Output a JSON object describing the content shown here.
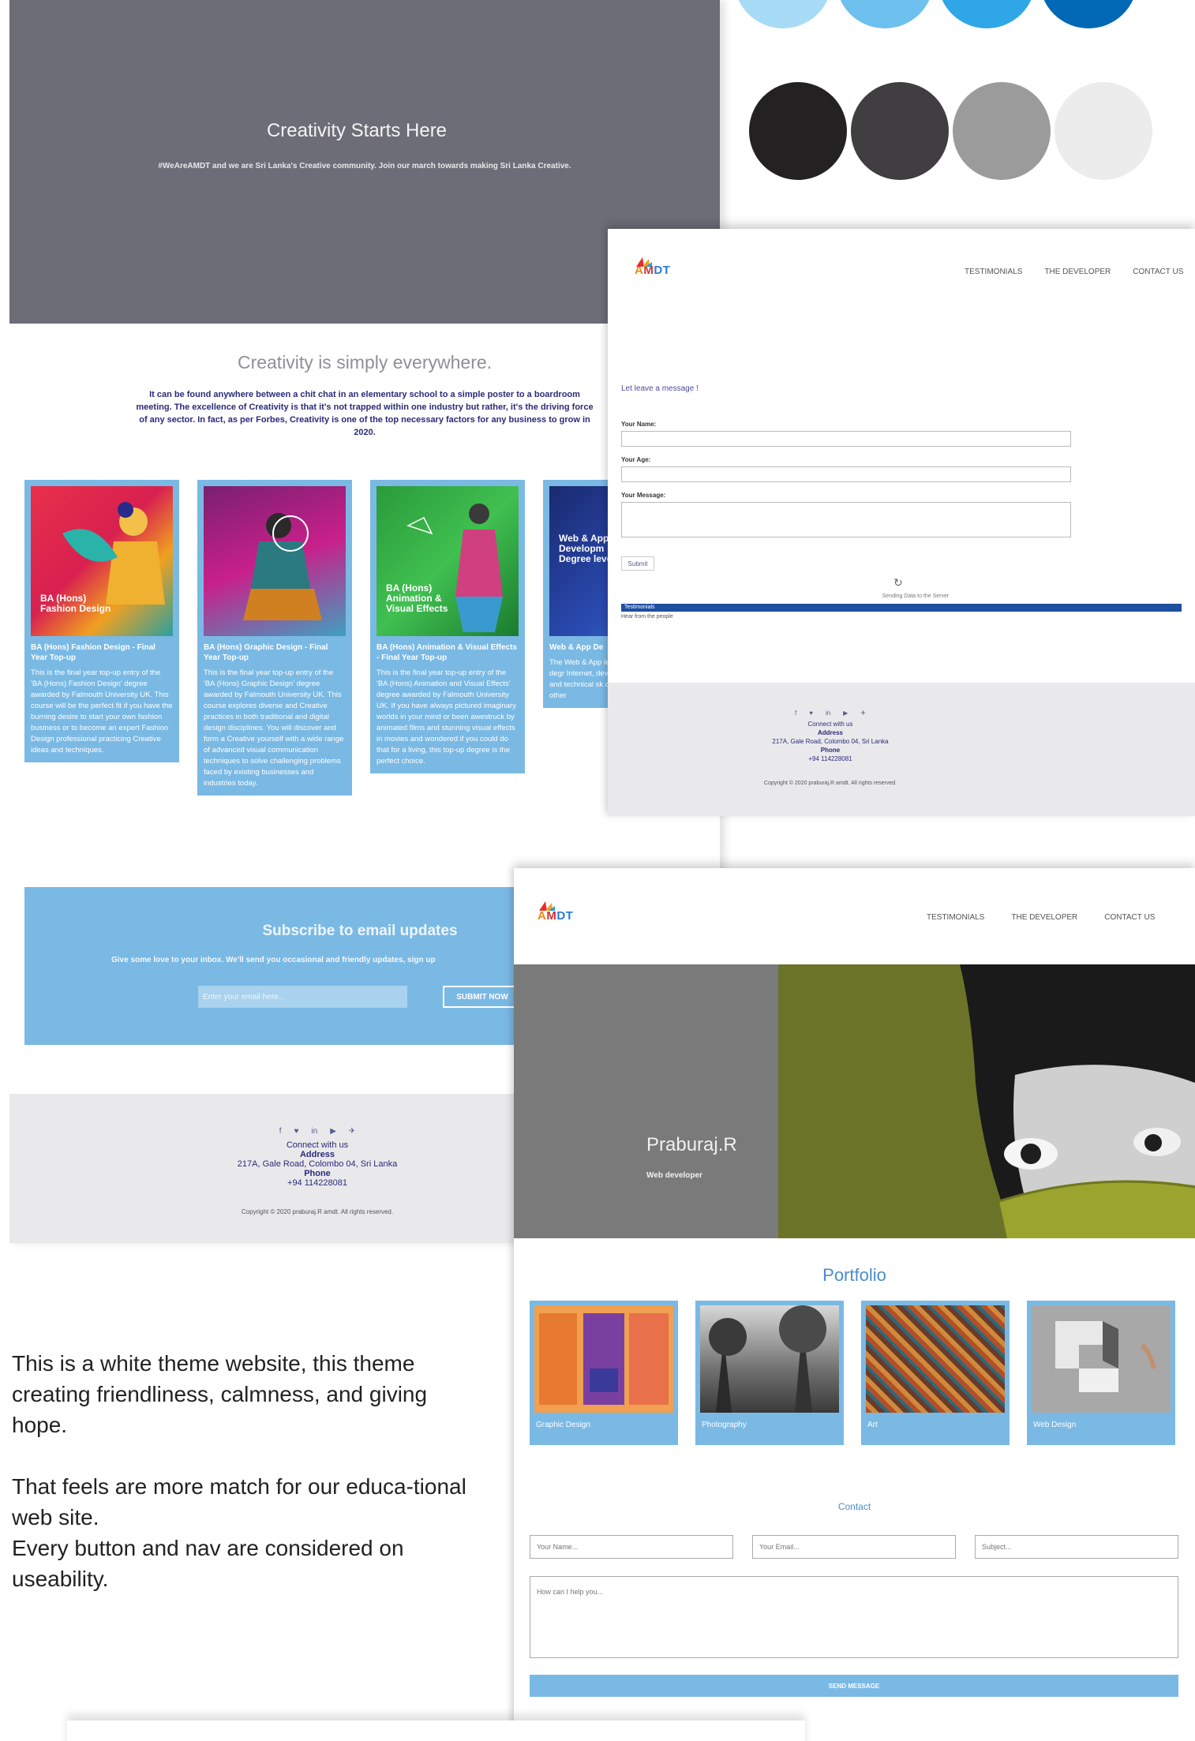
{
  "palette": {
    "blues": [
      "#a8dcf6",
      "#6ec0ee",
      "#2fa6e6",
      "#0068b4"
    ],
    "grays": [
      "#232122",
      "#403e40",
      "#9b9b9b",
      "#ececec"
    ]
  },
  "main_site": {
    "hero": {
      "title": "Creativity Starts Here",
      "subtitle": "#WeAreAMDT and we are Sri Lanka's Creative community. Join our march towards making Sri Lanka Creative."
    },
    "intro": {
      "title": "Creativity is simply everywhere.",
      "text": "It can be found anywhere between a chit chat in an elementary school to a simple poster to a boardroom meeting. The excellence of Creativity is that it's not trapped within one industry but rather, it's the driving force of any sector. In fact, as per Forbes, Creativity is one of the top necessary factors for any business to grow in 2020."
    },
    "courses": [
      {
        "overlay": "BA (Hons)\nFashion Design",
        "title": "BA (Hons) Fashion Design - Final Year Top-up",
        "desc": "This is the final year top-up entry of the 'BA (Hons) Fashion Design' degree awarded by Falmouth University UK. This course will be the perfect fit if you have the burning desire to start your own fashion business or to become an expert Fashion Design professional practicing Creative ideas and techniques."
      },
      {
        "overlay": "",
        "title": "BA (Hons) Graphic Design - Final Year Top-up",
        "desc": "This is the final year top-up entry of the 'BA (Hons) Graphic Design' degree awarded by Falmouth University UK. This course explores diverse and Creative practices in both traditional and digital design disciplines. You will discover and form a Creative yourself with a wide range of advanced visual communication techniques to solve challenging problems faced by existing businesses and industries today."
      },
      {
        "overlay": "BA (Hons)\nAnimation &\nVisual Effects",
        "title": "BA (Hons) Animation & Visual Effects - Final Year Top-up",
        "desc": "This is the final year top-up entry of the 'BA (Hons) Animation and Visual Effects' degree awarded by Falmouth University UK. If you have always pictured imaginary worlds in your mind or been awestruck by animated films and stunning visual effects in movies and wondered if you could do that for a living, this top-up degree is the perfect choice."
      },
      {
        "overlay": "Web & App\nDevelopm\nDegree level",
        "title": "Web & App De",
        "desc": "The Web & App level course ar Creativity degr Internet, develop The course aims and technical sk careers for the w various other"
      }
    ],
    "subscribe": {
      "title": "Subscribe to email updates",
      "text": "Give some love to your inbox. We'll send you occasional and friendly updates, sign up",
      "placeholder": "Enter your email here...",
      "button": "SUBMIT NOW"
    },
    "footer": {
      "social": [
        "f",
        "♥",
        "in",
        "▶",
        "✈"
      ],
      "connect": "Connect with us",
      "address_label": "Address",
      "address": "217A, Gale Road, Colombo 04, Sri Lanka",
      "phone_label": "Phone",
      "phone": "+94 114228081",
      "copyright": "Copyright © 2020 praburaj.R amdt. All rights reserved."
    }
  },
  "note": {
    "p1": "This is a white theme website, this theme creating friendliness, calmness, and giving hope.",
    "p2a": "That feels are more match for our educa-tional web site.",
    "p2b": "Every button and nav are considered on useability."
  },
  "nav": {
    "items": [
      "TESTIMONIALS",
      "THE DEVELOPER",
      "CONTACT US"
    ]
  },
  "logo": {
    "a": "A",
    "m": "M",
    "d": "D",
    "t": "T"
  },
  "contact_page": {
    "heading": "Let leave a message !",
    "name_label": "Your Name:",
    "age_label": "Your Age:",
    "message_label": "Your Message:",
    "submit": "Submit",
    "spinner": "↻",
    "sending": "Sending Data to the Server",
    "testimonials": "Testimonials",
    "testimonials_sub": "Hear from the people",
    "footer": {
      "connect": "Connect with us",
      "address_label": "Address",
      "address": "217A, Gale Road, Colombo 04, Sri Lanka",
      "phone_label": "Phone",
      "phone": "+94 114228081",
      "copyright": "Copyright © 2020 praburaj.R amdt. All rights reserved."
    }
  },
  "portfolio_page": {
    "name": "Praburaj.R",
    "role": "Web developer",
    "title": "Portfolio",
    "items": [
      "Graphic Design",
      "Photography",
      "Art",
      "Web Design"
    ],
    "contact_title": "Contact",
    "name_placeholder": "Your Name...",
    "email_placeholder": "Your Email...",
    "subject_placeholder": "Subject...",
    "message_placeholder": "How can I help you...",
    "send": "SEND MESSAGE"
  }
}
